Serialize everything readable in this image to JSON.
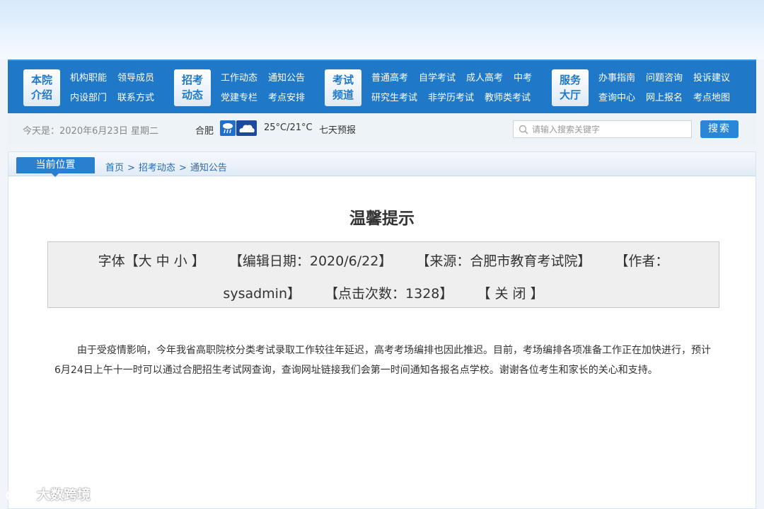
{
  "nav": {
    "groups": [
      {
        "badge": [
          "本院",
          "介绍"
        ],
        "rows": [
          [
            "机构职能",
            "领导成员"
          ],
          [
            "内设部门",
            "联系方式"
          ]
        ]
      },
      {
        "badge": [
          "招考",
          "动态"
        ],
        "rows": [
          [
            "工作动态",
            "通知公告"
          ],
          [
            "党建专栏",
            "考点安排"
          ]
        ]
      },
      {
        "badge": [
          "考试",
          "频道"
        ],
        "rows": [
          [
            "普通高考",
            "自学考试",
            "成人高考",
            "中考"
          ],
          [
            "研究生考试",
            "非学历考试",
            "教师类考试"
          ]
        ]
      },
      {
        "badge": [
          "服务",
          "大厅"
        ],
        "rows": [
          [
            "办事指南",
            "问题咨询",
            "投诉建议"
          ],
          [
            "查询中心",
            "网上报名",
            "考点地图"
          ]
        ]
      }
    ]
  },
  "info": {
    "today": "今天是：2020年6月23日 星期二",
    "city": "合肥",
    "weather_icons": [
      "rain-icon",
      "cloud-icon"
    ],
    "temperature": "25°C/21°C",
    "forecast_link": "七天预报"
  },
  "search": {
    "placeholder": "请输入搜索关键字",
    "button": "搜索"
  },
  "breadcrumb": {
    "label": "当前位置",
    "items": [
      "首页",
      "招考动态",
      "通知公告"
    ],
    "separator": ">"
  },
  "article": {
    "title": "温馨提示",
    "font_label": "字体【",
    "font_sizes": [
      "大",
      "中",
      "小"
    ],
    "font_close": "】",
    "edit_date": "【编辑日期：2020/6/22】",
    "source": "【来源：合肥市教育考试院】",
    "author_prefix": "【作者：",
    "author": "sysadmin】",
    "clicks": "【点击次数：1328】",
    "close": "【 关 闭 】",
    "body": "由于受疫情影响，今年我省高职院校分类考试录取工作较往年延迟，高考考场编排也因此推迟。目前，考场编排各项准备工作正在加快进行，预计6月24日上午十一时可以通过合肥招生考试网查询，查询网址链接我们会第一时间通知各报名点学校。谢谢各位考生和家长的关心和支持。"
  },
  "watermark": "大数跨境"
}
